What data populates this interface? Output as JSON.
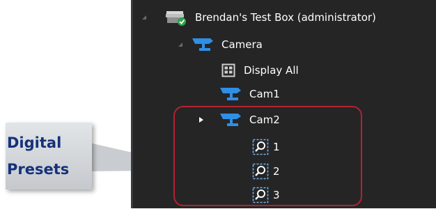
{
  "callout": {
    "line1": "Digital",
    "line2": "Presets"
  },
  "tree": {
    "server": {
      "label": "Brendan's Test Box (administrator)"
    },
    "camera_group": {
      "label": "Camera"
    },
    "display_all": {
      "label": "Display All"
    },
    "cam1": {
      "label": "Cam1"
    },
    "cam2": {
      "label": "Cam2"
    },
    "presets": [
      {
        "label": "1"
      },
      {
        "label": "2"
      },
      {
        "label": "3"
      }
    ]
  },
  "colors": {
    "panel_bg": "#252526",
    "camera_icon": "#2f8fe6",
    "highlight_border": "#b5222f",
    "callout_text": "#15317a"
  }
}
